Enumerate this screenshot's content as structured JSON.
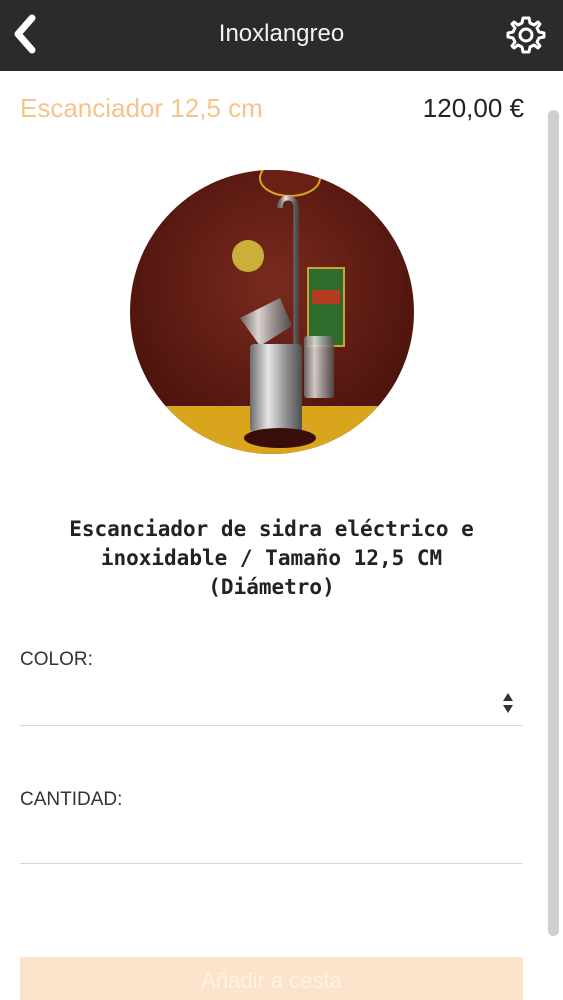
{
  "header": {
    "title": "Inoxlangreo",
    "back_icon": "chevron-left-icon",
    "settings_icon": "gear-icon",
    "background": "#2b2b2b"
  },
  "product": {
    "name": "Escanciador 12,5 cm",
    "price": "120,00 €",
    "description": "Escanciador de sidra eléctrico e inoxidable / Tamaño 12,5 CM (Diámetro)",
    "name_color": "#f5c48c"
  },
  "form": {
    "color_label": "COLOR:",
    "color_value": "",
    "quantity_label": "CANTIDAD:",
    "quantity_value": ""
  },
  "cart_button": {
    "label": "Añadir a cesta",
    "background": "#fbe3cc"
  }
}
